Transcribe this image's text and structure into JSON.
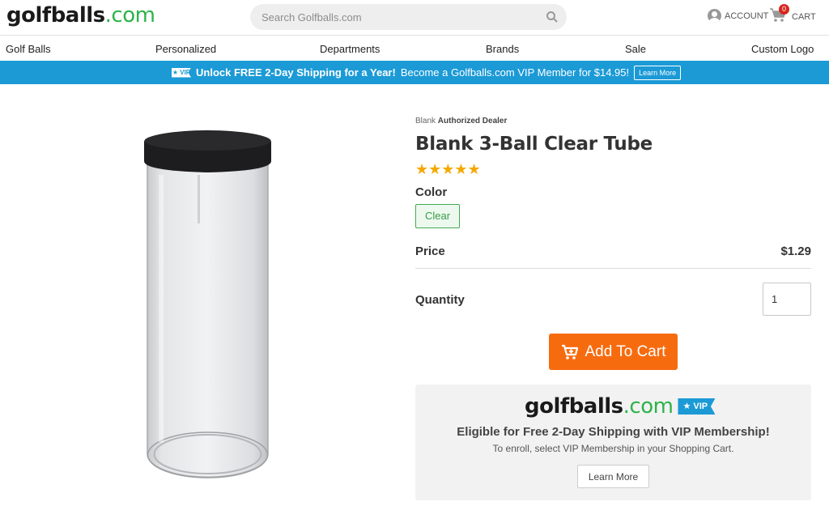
{
  "header": {
    "logo_part1": "golfballs",
    "logo_part2": ".com",
    "search_placeholder": "Search Golfballs.com",
    "account_label": "ACCOUNT",
    "cart_label": "CART",
    "cart_count": "0"
  },
  "nav": {
    "items": [
      "Golf Balls",
      "Personalized",
      "Departments",
      "Brands",
      "Sale",
      "Custom Logo"
    ]
  },
  "promo": {
    "vip_badge": "★ VIP",
    "bold_text": "Unlock FREE 2-Day Shipping for a Year!",
    "text": "Become a Golfballs.com VIP Member for $14.95!",
    "button": "Learn More"
  },
  "product": {
    "brand": "Blank",
    "dealer": "Authorized Dealer",
    "title": "Blank 3-Ball Clear Tube",
    "rating": 5,
    "stars": "★★★★★",
    "color_label": "Color",
    "color_value": "Clear",
    "price_label": "Price",
    "price": "$1.29",
    "quantity_label": "Quantity",
    "quantity": "1",
    "add_to_cart": "Add To Cart"
  },
  "vip_box": {
    "logo_part1": "golfballs",
    "logo_part2": ".com",
    "flag": "★ VIP",
    "headline": "Eligible for Free 2-Day Shipping with VIP Membership!",
    "subline": "To enroll, select VIP Membership in your Shopping Cart.",
    "button": "Learn More"
  },
  "colors": {
    "brand_green": "#2db34a",
    "promo_blue": "#1b9ad6",
    "cta_orange": "#f76b0f",
    "star_gold": "#f5a800"
  }
}
